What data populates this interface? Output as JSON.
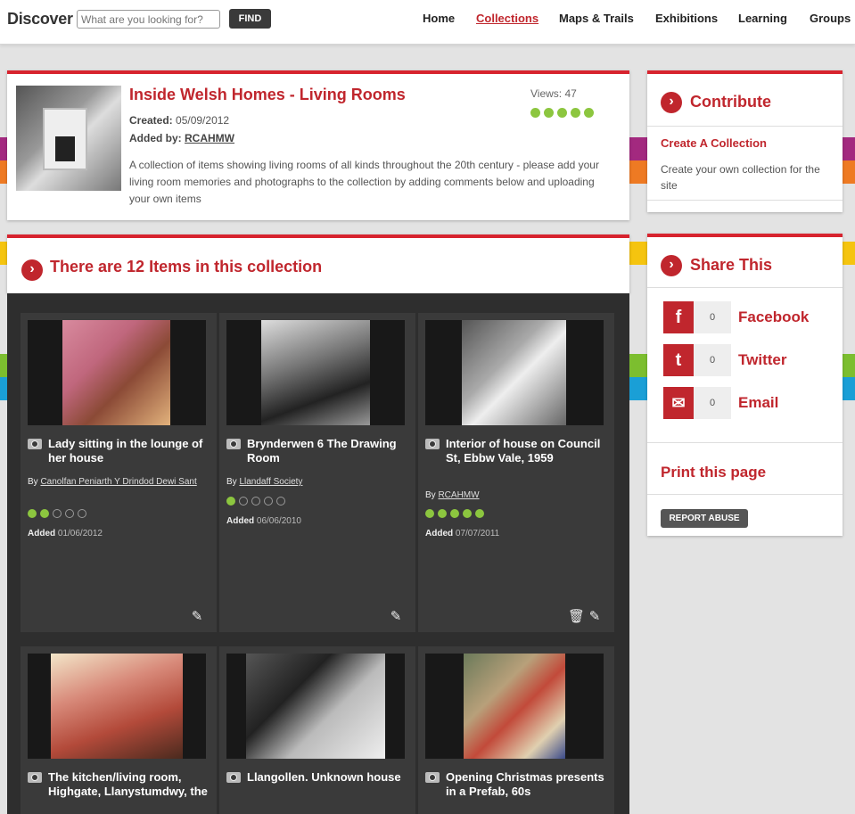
{
  "header": {
    "logo": "Discover",
    "search_placeholder": "What are you looking for?",
    "find_label": "FIND",
    "nav": [
      {
        "label": "Home"
      },
      {
        "label": "Collections",
        "active": true
      },
      {
        "label": "Maps & Trails"
      },
      {
        "label": "Exhibitions"
      },
      {
        "label": "Learning"
      },
      {
        "label": "Groups"
      }
    ]
  },
  "collection": {
    "title": "Inside Welsh Homes - Living Rooms",
    "created_label": "Created:",
    "created": "05/09/2012",
    "added_by_label": "Added by:",
    "added_by": "RCAHMW",
    "views": "Views: 47",
    "rating": 5,
    "description": "A collection of items showing living rooms of all kinds throughout the 20th century - please add your living room memories and photographs to the collection by adding comments below and uploading your own items"
  },
  "items_header": "There are 12 Items in this collection",
  "items": [
    {
      "title": "Lady sitting in the lounge of her house",
      "by_label": "By",
      "by": "Canolfan Peniarth Y Drindod Dewi Sant",
      "rating": 2,
      "added_label": "Added",
      "added": "01/06/2012"
    },
    {
      "title": "Brynderwen 6 The Drawing Room",
      "by_label": "By",
      "by": "Llandaff Society",
      "rating": 1,
      "added_label": "Added",
      "added": "06/06/2010"
    },
    {
      "title": "Interior of house on Council St, Ebbw Vale, 1959",
      "by_label": "By",
      "by": "RCAHMW",
      "rating": 5,
      "added_label": "Added",
      "added": "07/07/2011"
    },
    {
      "title": "The kitchen/living room, Highgate, Llanystumdwy, the"
    },
    {
      "title": "Llangollen. Unknown house"
    },
    {
      "title": "Opening Christmas presents in a Prefab, 60s"
    }
  ],
  "contribute": {
    "title": "Contribute",
    "link": "Create A Collection",
    "desc": "Create your own collection for the site"
  },
  "share": {
    "title": "Share This",
    "items": [
      {
        "icon": "facebook-icon",
        "glyph": "f",
        "count": "0",
        "label": "Facebook"
      },
      {
        "icon": "twitter-icon",
        "glyph": "t",
        "count": "0",
        "label": "Twitter"
      },
      {
        "icon": "email-icon",
        "glyph": "✉",
        "count": "0",
        "label": "Email"
      }
    ],
    "print": "Print this page",
    "report": "REPORT ABUSE"
  },
  "colors": {
    "accent": "#c0262d",
    "rating": "#8cc63f",
    "dark_panel": "#2e2e2e"
  }
}
